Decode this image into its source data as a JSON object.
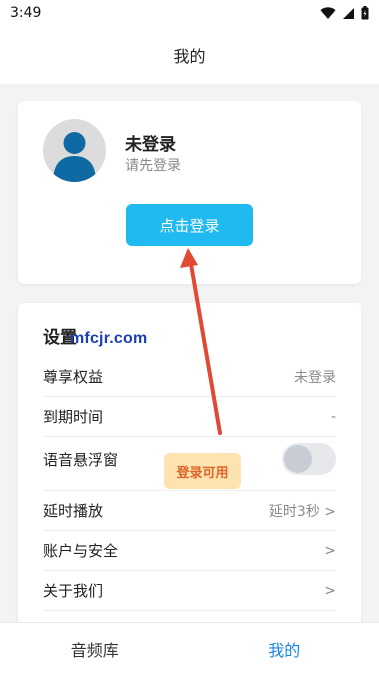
{
  "status_bar": {
    "time": "3:49",
    "icons": [
      "wifi-icon",
      "signal-icon",
      "battery-icon"
    ]
  },
  "header": {
    "title": "我的"
  },
  "profile": {
    "name": "未登录",
    "subtitle": "请先登录",
    "login_button": "点击登录",
    "avatar_icon": "user-avatar-icon"
  },
  "settings": {
    "title": "设置",
    "watermark": "mfcjr.com",
    "rows": [
      {
        "label": "尊享权益",
        "value": "未登录"
      },
      {
        "label": "到期时间",
        "value": "-"
      },
      {
        "label": "语音悬浮窗",
        "badge": "登录可用",
        "toggle_on": false
      },
      {
        "label": "延时播放",
        "value": "延时3秒 >"
      },
      {
        "label": "账户与安全",
        "value": ">"
      },
      {
        "label": "关于我们",
        "value": ">"
      }
    ]
  },
  "tabs": [
    {
      "label": "音频库",
      "active": false
    },
    {
      "label": "我的",
      "active": true
    }
  ],
  "colors": {
    "accent": "#20b9f0",
    "tab_active": "#1a86e8",
    "badge_bg": "#fde3b0",
    "badge_text": "#e0662a",
    "arrow": "#e04a35"
  }
}
